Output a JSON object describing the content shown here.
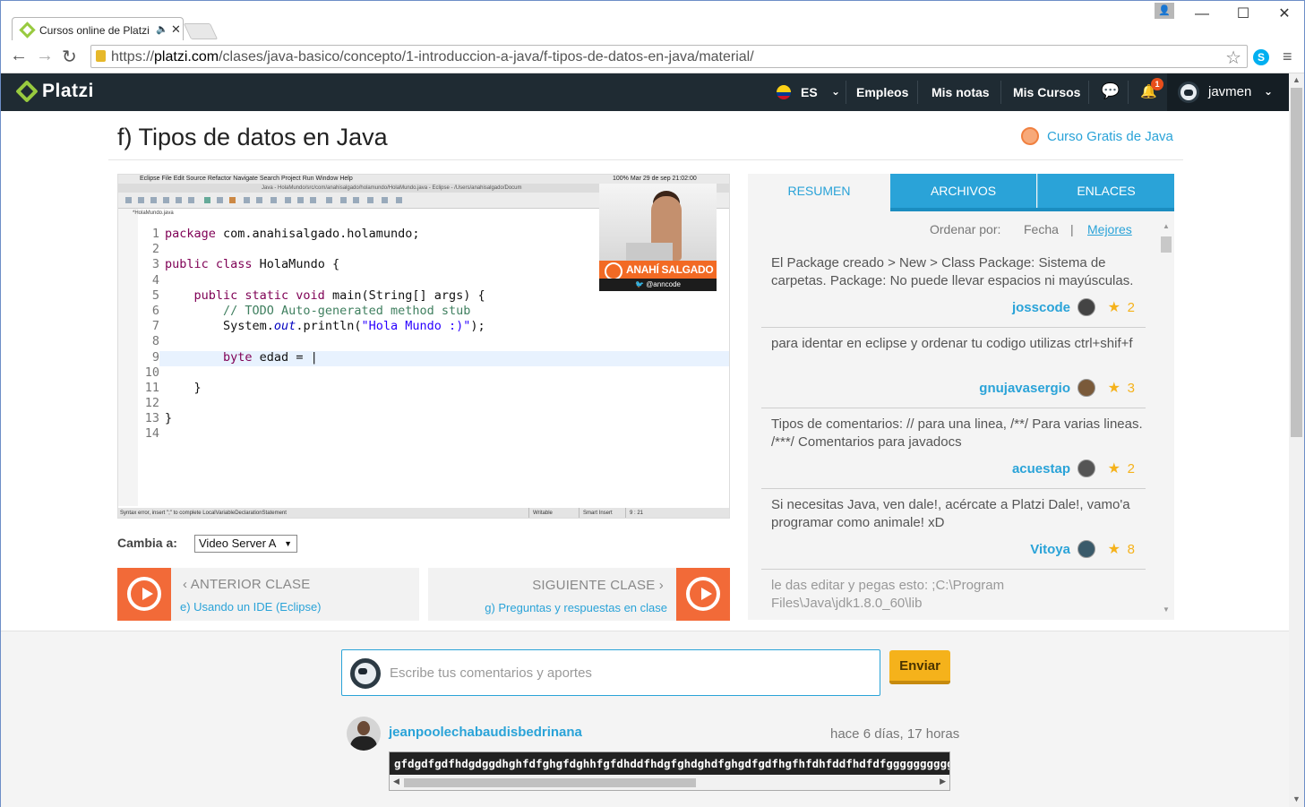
{
  "browser": {
    "tab_title": "Cursos online de Platzi",
    "url_domain": "platzi.com",
    "url_scheme": "https://",
    "url_path": "/clases/java-basico/concepto/1-introduccion-a-java/f-tipos-de-datos-en-java/material/"
  },
  "topnav": {
    "brand": "Platzi",
    "lang": "ES",
    "items": [
      "Empleos",
      "Mis notas",
      "Mis Cursos"
    ],
    "notification_count": "1",
    "username": "javmen"
  },
  "page": {
    "title": "f) Tipos de datos en Java",
    "course_link": "Curso Gratis de Java"
  },
  "video": {
    "mac_menu": "Eclipse   File   Edit   Source   Refactor   Navigate   Search   Project   Run   Window   Help",
    "mac_clock": "100%   Mar 29 de sep  21:02:00",
    "ide_title": "Java - HolaMundo/src/com/anahisalgado/holamundo/HolaMundo.java - Eclipse - /Users/anahisalgado/Docum",
    "editor_tab": "*HolaMundo.java",
    "presenter_name": "ANAHÍ SALGADO",
    "presenter_twitter": "@anncode",
    "status_hint": "Syntax error, insert \";\" to complete LocalVariableDeclarationStatement",
    "status_writable": "Writable",
    "status_insert": "Smart Insert",
    "status_pos": "9 : 21",
    "code_lines": [
      {
        "n": "1",
        "html": "<span class='kw'>package</span> com.anahisalgado.holamundo;"
      },
      {
        "n": "2",
        "html": ""
      },
      {
        "n": "3",
        "html": "<span class='kw'>public class</span> HolaMundo {"
      },
      {
        "n": "4",
        "html": ""
      },
      {
        "n": "5",
        "html": "    <span class='kw'>public static void</span> main(String[] args) {"
      },
      {
        "n": "6",
        "html": "        <span class='cm'>// TODO Auto-generated method stub</span>"
      },
      {
        "n": "7",
        "html": "        System.<span class='it'>out</span>.println(<span class='st'>\"Hola Mundo :)\"</span>);"
      },
      {
        "n": "8",
        "html": ""
      },
      {
        "n": "9",
        "html": "        <span class='kw'>byte</span> edad = |"
      },
      {
        "n": "10",
        "html": ""
      },
      {
        "n": "11",
        "html": "    }"
      },
      {
        "n": "12",
        "html": ""
      },
      {
        "n": "13",
        "html": "}"
      },
      {
        "n": "14",
        "html": ""
      }
    ]
  },
  "server": {
    "label": "Cambia a:",
    "selected": "Video Server A"
  },
  "prev": {
    "label": "ANTERIOR CLASE",
    "link": "e) Usando un IDE (Eclipse)"
  },
  "next": {
    "label": "SIGUIENTE CLASE",
    "link": "g) Preguntas y respuestas en clase"
  },
  "panel": {
    "tabs": [
      "RESUMEN",
      "ARCHIVOS",
      "ENLACES"
    ],
    "sort_label": "Ordenar por:",
    "sort_fecha": "Fecha",
    "sort_sep": "|",
    "sort_mejores": "Mejores",
    "comments": [
      {
        "text": "El Package creado > New > Class Package: Sistema de carpetas. Package: No puede llevar espacios ni mayúsculas.",
        "user": "josscode",
        "stars": "2"
      },
      {
        "text": "para identar en eclipse y ordenar tu codigo utilizas ctrl+shif+f",
        "user": "gnujavasergio",
        "stars": "3"
      },
      {
        "text": "Tipos de comentarios: // para una linea, /**/ Para varias lineas. /***/ Comentarios para javadocs",
        "user": "acuestap",
        "stars": "2"
      },
      {
        "text": "Si necesitas Java, ven dale!, acércate a Platzi Dale!, vamo'a programar como animale! xD",
        "user": "Vitoya",
        "stars": "8"
      },
      {
        "text": "le das editar y pegas esto: ;C:\\Program Files\\Java\\jdk1.8.0_60\\lib",
        "user": "",
        "stars": ""
      }
    ]
  },
  "compose": {
    "placeholder": "Escribe tus comentarios y aportes",
    "send": "Enviar"
  },
  "post": {
    "user": "jeanpoolechabaudisbedrinana",
    "time": "hace 6 días, 17 horas",
    "code": "gfdgdfgdfhdgdggdhghfdfghgfdghhfgfdhddfhdgfghdghdfghgdfgdfhgfhfdhfddfhdfdfgggggggggggggggg"
  },
  "colors": {
    "accent": "#2aa3d8",
    "orange": "#f26a38",
    "nav": "#1f2b33",
    "star": "#f5b21b"
  }
}
